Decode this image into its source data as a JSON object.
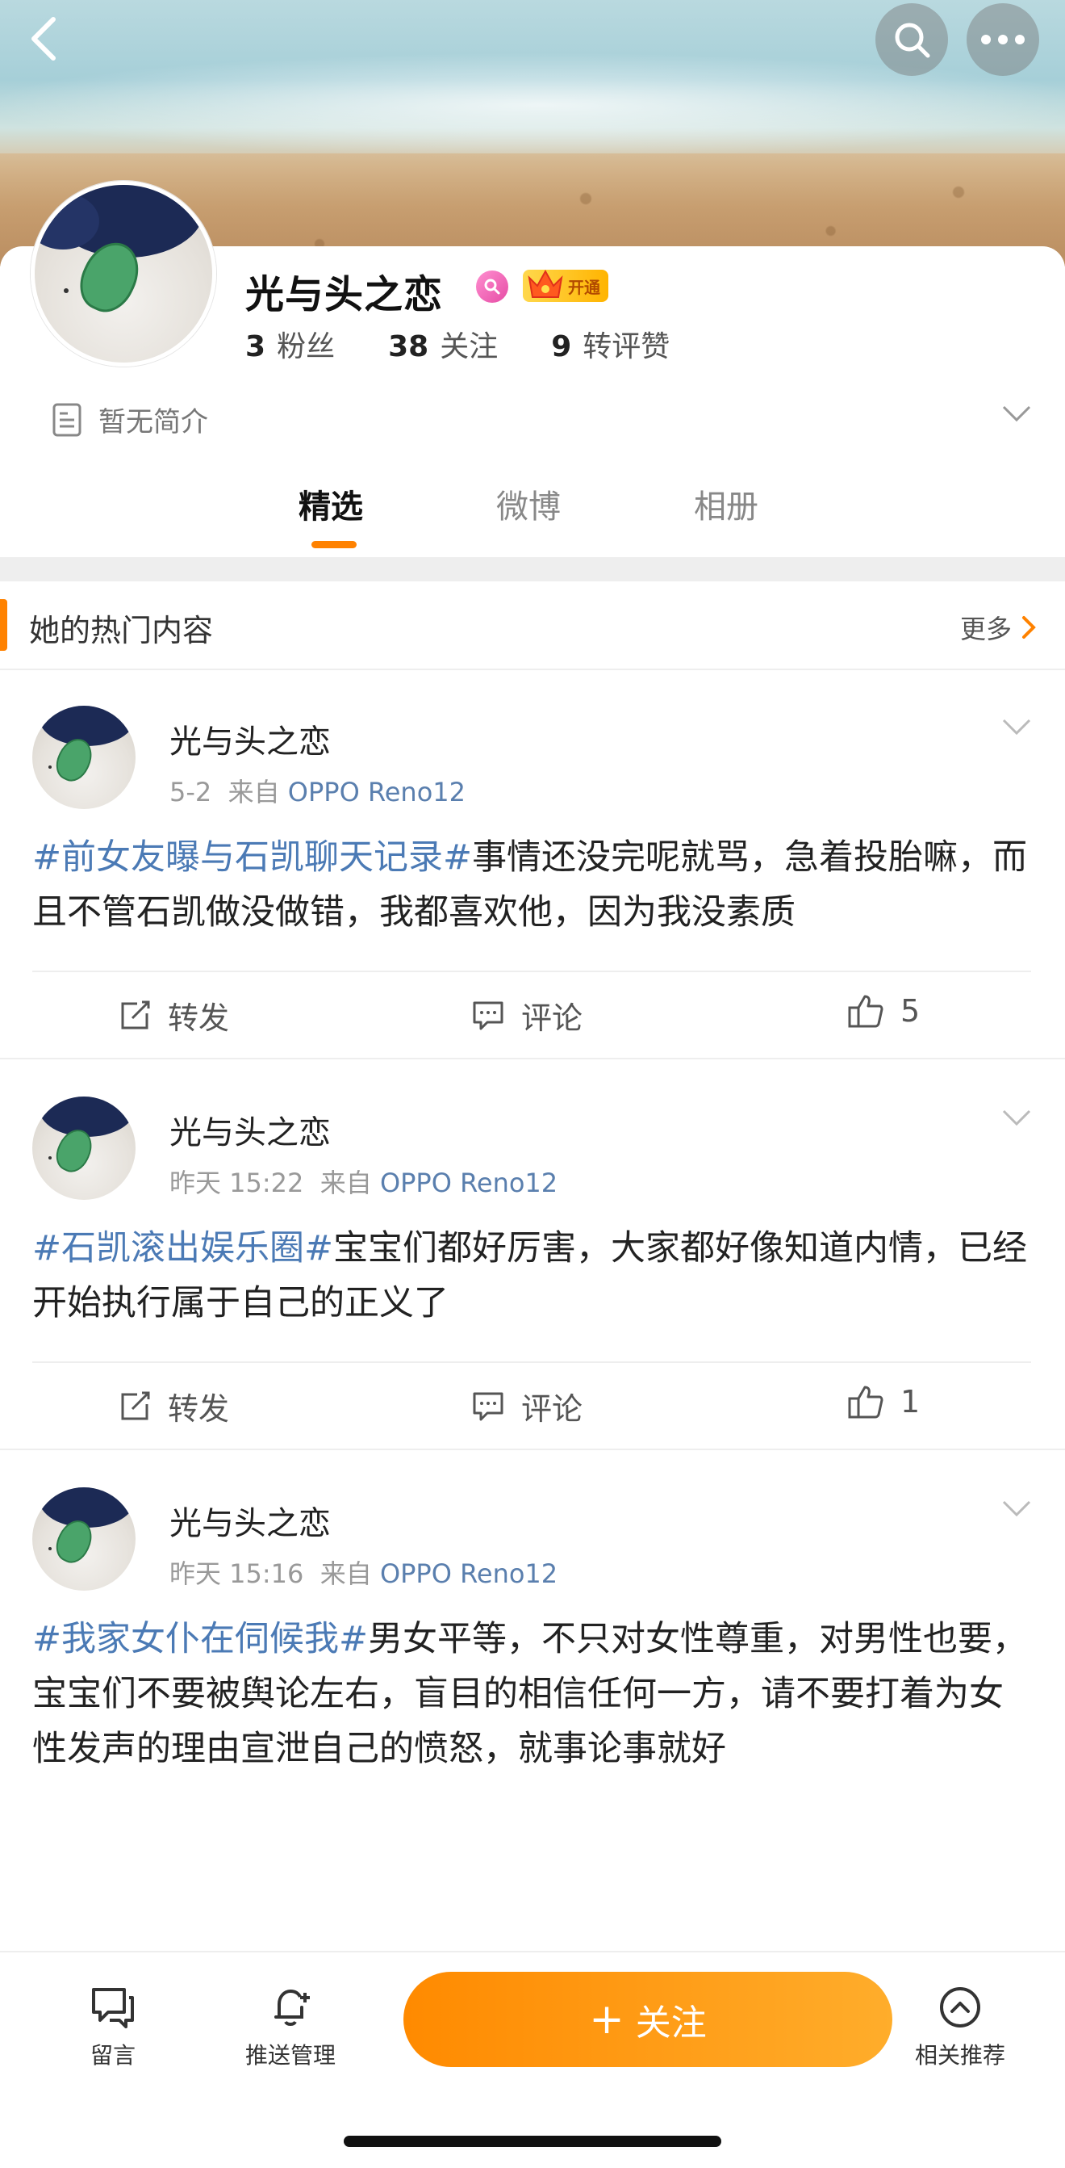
{
  "profile": {
    "name": "光与头之恋",
    "vip_label": "开通",
    "stats": [
      {
        "num": "3",
        "label": "粉丝"
      },
      {
        "num": "38",
        "label": "关注"
      },
      {
        "num": "9",
        "label": "转评赞"
      }
    ],
    "intro": "暂无简介"
  },
  "tabs": [
    "精选",
    "微博",
    "相册"
  ],
  "hot": {
    "title": "她的热门内容",
    "more": "更多"
  },
  "posts": [
    {
      "author": "光与头之恋",
      "date": "5-2",
      "from_label": "来自",
      "source": "OPPO Reno12",
      "tag": "#前女友曝与石凯聊天记录#",
      "text": "事情还没完呢就骂，急着投胎嘛，而且不管石凯做没做错，我都喜欢他，因为我没素质",
      "repost": "转发",
      "comment": "评论",
      "likes": "5"
    },
    {
      "author": "光与头之恋",
      "date": "昨天 15:22",
      "from_label": "来自",
      "source": "OPPO Reno12",
      "tag": "#石凯滚出娱乐圈#",
      "text": "宝宝们都好厉害，大家都好像知道内情，已经开始执行属于自己的正义了",
      "repost": "转发",
      "comment": "评论",
      "likes": "1"
    },
    {
      "author": "光与头之恋",
      "date": "昨天 15:16",
      "from_label": "来自",
      "source": "OPPO Reno12",
      "tag": "#我家女仆在伺候我#",
      "text": "男女平等，不只对女性尊重，对男性也要，宝宝们不要被舆论左右，盲目的相信任何一方，请不要打着为女性发声的理由宣泄自己的愤怒，就事论事就好"
    }
  ],
  "bottom": {
    "message": "留言",
    "push": "推送管理",
    "follow": "关注",
    "follow_plus": "+",
    "related": "相关推荐"
  },
  "colors": {
    "accent": "#ff8200",
    "link": "#4b7ab5"
  },
  "icons": [
    "back-icon",
    "search-icon",
    "more-icon",
    "document-icon",
    "chevron-down-icon",
    "chevron-right-icon",
    "share-icon",
    "comment-icon",
    "like-icon",
    "message-icon",
    "bell-icon",
    "arrow-up-circle-icon"
  ]
}
